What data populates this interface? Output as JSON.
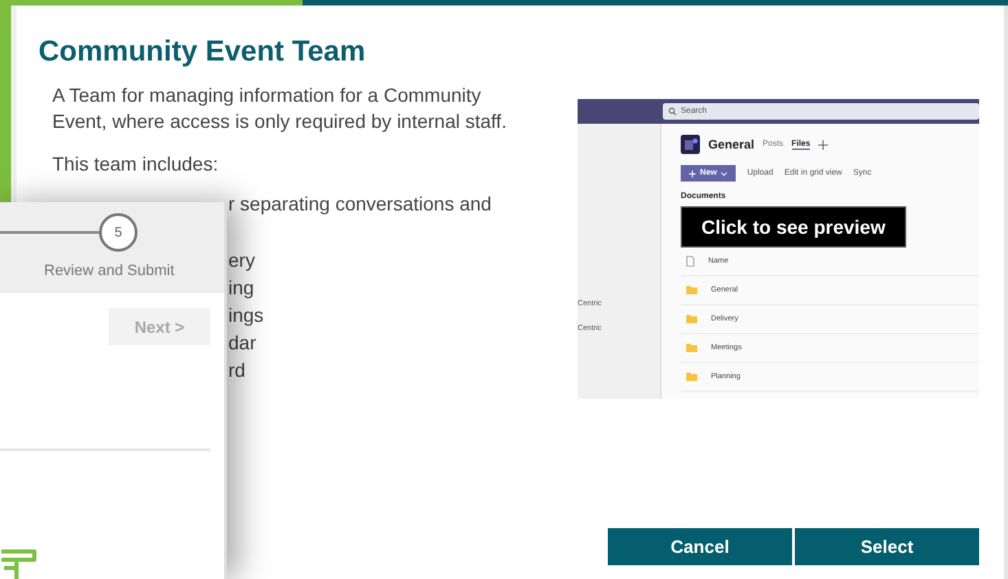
{
  "dialog": {
    "title": "Community Event Team",
    "description": "A Team for managing information for a Community Event, where access is only required by internal staff.",
    "includes_label": "This team includes:",
    "feature_fragments": [
      "r separating conversations and",
      "ery",
      "ing",
      "ings",
      "dar",
      "rd"
    ],
    "preview": {
      "search_placeholder": "Search",
      "sidebar_items": [
        "Centric",
        "Centric"
      ],
      "channel": "General",
      "tabs": [
        {
          "label": "Posts",
          "selected": false
        },
        {
          "label": "Files",
          "selected": true
        }
      ],
      "new_button": "New",
      "toolbar": [
        "Upload",
        "Edit in grid view",
        "Sync"
      ],
      "library": "Documents",
      "overlay": "Click to see preview",
      "column": "Name",
      "rows": [
        "General",
        "Delivery",
        "Meetings",
        "Planning"
      ]
    },
    "buttons": [
      "Cancel",
      "Select"
    ]
  },
  "wizard": {
    "step_number": "5",
    "step_label": "Review and Submit",
    "next_button": {
      "label": "Next >",
      "disabled": true
    }
  }
}
